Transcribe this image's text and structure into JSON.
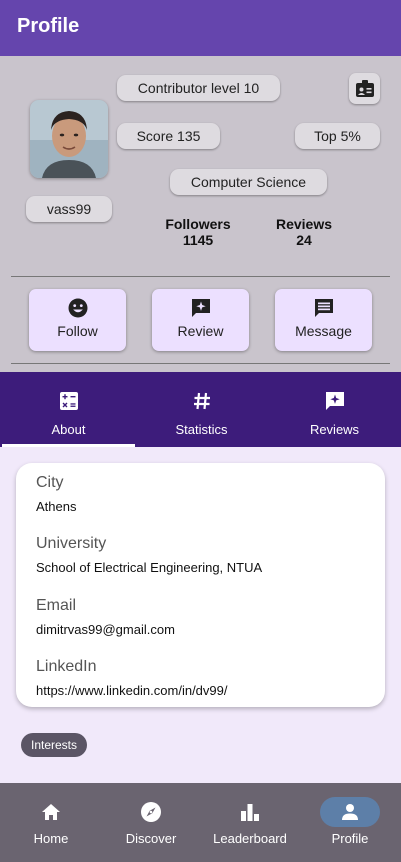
{
  "appbar": {
    "title": "Profile"
  },
  "profile": {
    "contributor_level": "Contributor level 10",
    "score": "Score 135",
    "top": "Top 5%",
    "field": "Computer Science",
    "username": "vass99",
    "followers_label": "Followers",
    "followers_value": "1145",
    "reviews_label": "Reviews",
    "reviews_value": "24"
  },
  "actions": [
    {
      "label": "Follow",
      "icon": "smiley-icon"
    },
    {
      "label": "Review",
      "icon": "review-sparkle-icon"
    },
    {
      "label": "Message",
      "icon": "message-icon"
    }
  ],
  "tabs": [
    {
      "label": "About",
      "icon": "calculator-icon",
      "active": true
    },
    {
      "label": "Statistics",
      "icon": "hash-icon"
    },
    {
      "label": "Reviews",
      "icon": "review-sparkle-icon"
    }
  ],
  "about": {
    "city_label": "City",
    "city_value": "Athens",
    "university_label": "University",
    "university_value": "School of Electrical Engineering, NTUA",
    "email_label": "Email",
    "email_value": "dimitrvas99@gmail.com",
    "linkedin_label": "LinkedIn",
    "linkedin_value": "https://www.linkedin.com/in/dv99/"
  },
  "interests": "Interests",
  "nav": [
    {
      "label": "Home",
      "icon": "home-icon"
    },
    {
      "label": "Discover",
      "icon": "compass-icon"
    },
    {
      "label": "Leaderboard",
      "icon": "leaderboard-icon"
    },
    {
      "label": "Profile",
      "icon": "person-icon",
      "active": true
    }
  ],
  "colors": {
    "appbar": "#6545ad",
    "tabs": "#3d1c7b",
    "header_bg": "#c9c4cc",
    "action_bg": "#ece0ff",
    "bottom_nav": "#6a6470",
    "active_nav_pill": "#5d7fa8"
  }
}
